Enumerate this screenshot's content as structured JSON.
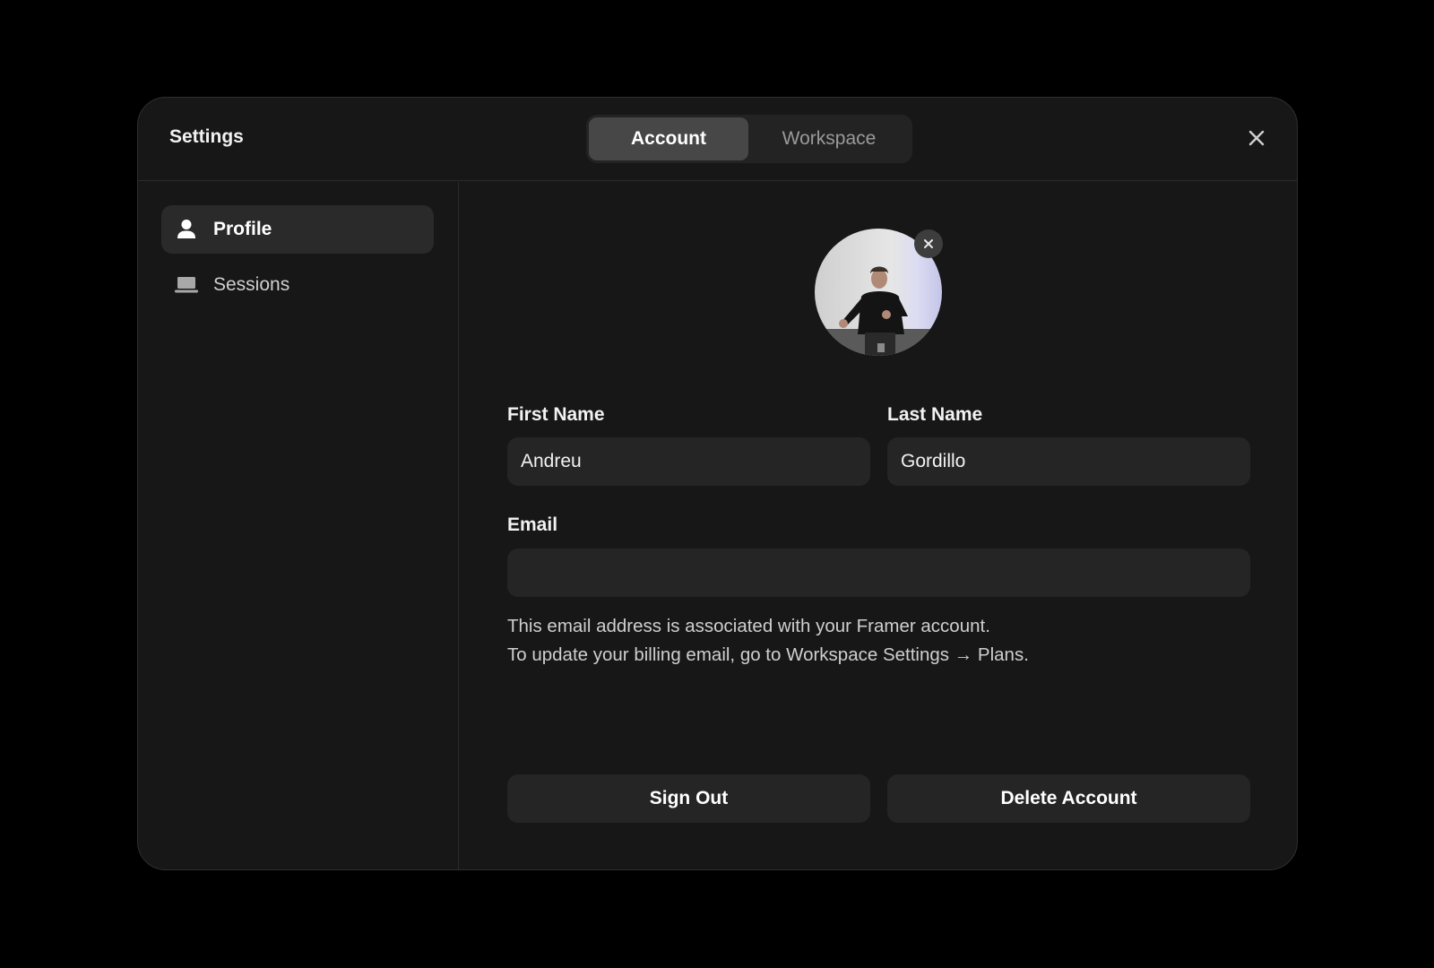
{
  "header": {
    "title": "Settings",
    "tabs": [
      {
        "label": "Account",
        "active": true
      },
      {
        "label": "Workspace",
        "active": false
      }
    ],
    "close_icon": "close-icon"
  },
  "sidebar": {
    "items": [
      {
        "label": "Profile",
        "icon": "user-icon",
        "active": true
      },
      {
        "label": "Sessions",
        "icon": "laptop-icon",
        "active": false
      }
    ]
  },
  "profile": {
    "avatar_icon": "avatar-photo",
    "remove_avatar_icon": "close-icon",
    "first_name_label": "First Name",
    "first_name_value": "Andreu",
    "last_name_label": "Last Name",
    "last_name_value": "Gordillo",
    "email_label": "Email",
    "email_value": "",
    "help_line_1": "This email address is associated with your Framer account.",
    "help_line_2": "To update your billing email, go to Workspace Settings → Plans.",
    "sign_out_label": "Sign Out",
    "delete_account_label": "Delete Account"
  },
  "colors": {
    "page_bg": "#000000",
    "modal_bg": "#171717",
    "field_bg": "#252525",
    "active_tab_bg": "#474747"
  }
}
